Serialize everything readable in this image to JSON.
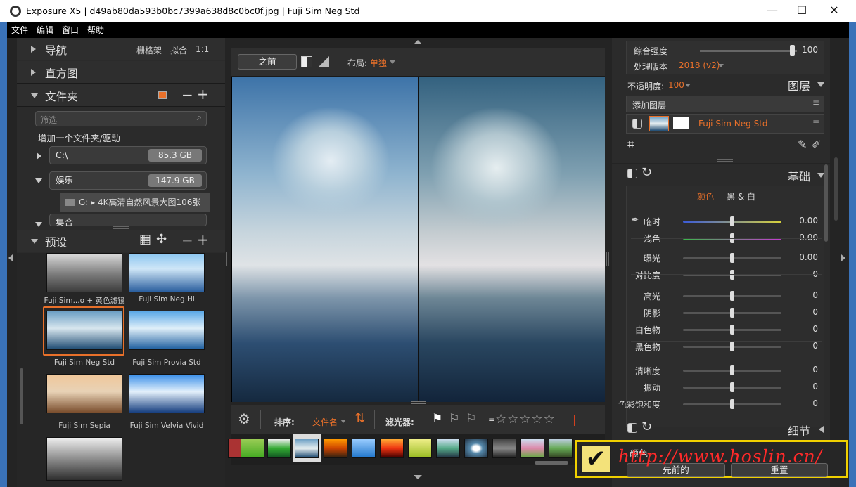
{
  "window": {
    "title": "Exposure X5 | d49ab80da593b0bc7399a638d8c0bc0f.jpg | Fuji Sim Neg Std",
    "minimize": "—",
    "maximize": "☐",
    "close": "✕"
  },
  "menu": [
    "文件",
    "编辑",
    "窗口",
    "帮助"
  ],
  "nav": {
    "title": "导航",
    "grid": "栅格架",
    "fit": "拟合",
    "one": "1:1"
  },
  "histogram": {
    "title": "直方图"
  },
  "folders": {
    "title": "文件夹",
    "search_placeholder": "筛选",
    "add_folder": "增加一个文件夹/驱动",
    "drives": [
      {
        "label": "C:\\",
        "size": "85.3 GB"
      },
      {
        "label": "娱乐",
        "size": "147.9 GB"
      }
    ],
    "subfolder": "G: ▸ 4K高清自然风景大图106张",
    "collections": "集合"
  },
  "presets": {
    "title": "预设",
    "items": [
      "Fuji Sim...o + 黄色滤镜",
      "Fuji Sim Neg Hi",
      "Fuji Sim Neg Std",
      "Fuji Sim Provia Std",
      "Fuji Sim Sepia",
      "Fuji Sim Velvia Vivid"
    ]
  },
  "viewer": {
    "before": "之前",
    "layout_label": "布局:",
    "layout_value": "单独"
  },
  "filmbar": {
    "sort_label": "排序:",
    "sort_value": "文件名",
    "filter_label": "滤光器:",
    "eq": "=",
    "stars": "☆☆☆☆☆"
  },
  "right": {
    "intensity_label": "综合强度",
    "intensity_value": "100",
    "intensity_fraction": 0.95,
    "version_label": "处理版本",
    "version_value": "2018 (v2)",
    "opacity_label": "不透明度:",
    "opacity_value": "100",
    "layers_title": "图层",
    "add_layer": "添加图层",
    "layer_name": "Fuji Sim Neg Std",
    "basic_title": "基础",
    "tab_color": "颜色",
    "tab_bw": "黑 & 白",
    "sliders": [
      {
        "label": "临时",
        "value": "0.00",
        "pos": 0.5
      },
      {
        "label": "浅色",
        "value": "0.00",
        "pos": 0.5
      },
      {
        "label": "曝光",
        "value": "0.00",
        "pos": 0.5
      },
      {
        "label": "对比度",
        "value": "0",
        "pos": 0.5
      },
      {
        "label": "高光",
        "value": "0",
        "pos": 0.5
      },
      {
        "label": "阴影",
        "value": "0",
        "pos": 0.5
      },
      {
        "label": "白色物",
        "value": "0",
        "pos": 0.5
      },
      {
        "label": "黑色物",
        "value": "0",
        "pos": 0.5
      },
      {
        "label": "清晰度",
        "value": "0",
        "pos": 0.5
      },
      {
        "label": "振动",
        "value": "0",
        "pos": 0.5
      },
      {
        "label": "色彩饱和度",
        "value": "0",
        "pos": 0.5
      }
    ],
    "detail_title": "细节",
    "color_title": "颜色",
    "prev_btn": "先前的",
    "reset_btn": "重置"
  },
  "watermark": {
    "url": "http://www.hoslin.cn/"
  },
  "colors": {
    "accent": "#e8702a",
    "bg": "#242424",
    "watermark": "#ff2a2a"
  }
}
